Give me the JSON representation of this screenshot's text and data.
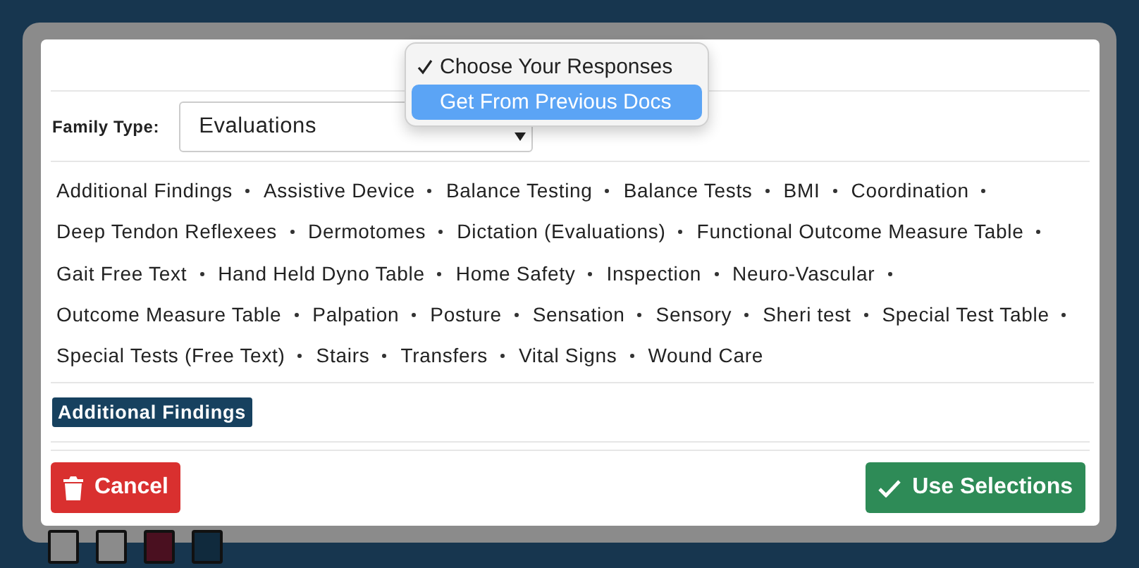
{
  "response_menu": {
    "options": [
      {
        "label": "Choose Your Responses",
        "selected": true,
        "highlighted": false
      },
      {
        "label": "Get From Previous Docs",
        "selected": false,
        "highlighted": true
      }
    ]
  },
  "family_type": {
    "label": "Family Type:",
    "value": "Evaluations"
  },
  "findings": [
    "Additional Findings",
    "Assistive Device",
    "Balance Testing",
    "Balance Tests",
    "BMI",
    "Coordination",
    "Deep Tendon Reflexees",
    "Dermotomes",
    "Dictation (Evaluations)",
    "Functional Outcome Measure Table",
    "Gait Free Text",
    "Hand Held Dyno Table",
    "Home Safety",
    "Inspection",
    "Neuro-Vascular",
    "Outcome Measure Table",
    "Palpation",
    "Posture",
    "Sensation",
    "Sensory",
    "Sheri test",
    "Special Test Table",
    "Special Tests (Free Text)",
    "Stairs",
    "Transfers",
    "Vital Signs",
    "Wound Care"
  ],
  "selected_items": [
    "Additional Findings"
  ],
  "buttons": {
    "cancel": "Cancel",
    "use": "Use Selections"
  }
}
